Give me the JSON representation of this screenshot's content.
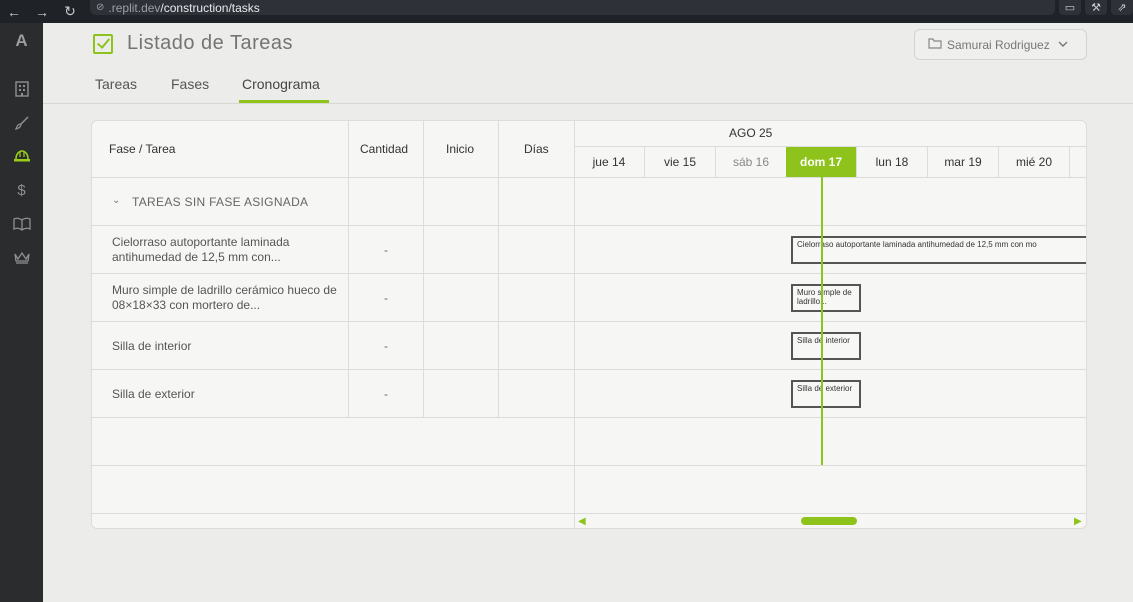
{
  "browser": {
    "url_host": ".replit.dev",
    "url_path": "/construction/tasks"
  },
  "sidebar": {
    "logo": "A",
    "items": [
      {
        "icon": "building-icon",
        "glyph": "▦"
      },
      {
        "icon": "brush-icon",
        "glyph": "✎"
      },
      {
        "icon": "hard-hat-icon",
        "glyph": "⛑"
      },
      {
        "icon": "dollar-icon",
        "glyph": "$"
      },
      {
        "icon": "book-icon",
        "glyph": "▯"
      },
      {
        "icon": "crown-icon",
        "glyph": "♕"
      }
    ],
    "active_color": "#9acd17"
  },
  "header": {
    "title": "Listado de Tareas",
    "user": "Samurai Rodriguez"
  },
  "tabs": {
    "items": [
      "Tareas",
      "Fases",
      "Cronograma"
    ],
    "active": "Cronograma"
  },
  "table": {
    "headers": {
      "phase_task": "Fase / Tarea",
      "quantity": "Cantidad",
      "start": "Inicio",
      "days": "Días"
    },
    "month": "AGO 25",
    "days": [
      {
        "label": "jue 14",
        "state": "normal"
      },
      {
        "label": "vie 15",
        "state": "normal"
      },
      {
        "label": "sáb 16",
        "state": "muted"
      },
      {
        "label": "dom 17",
        "state": "today"
      },
      {
        "label": "lun 18",
        "state": "normal"
      },
      {
        "label": "mar 19",
        "state": "normal"
      },
      {
        "label": "mié 20",
        "state": "normal"
      }
    ],
    "group": "TAREAS SIN FASE ASIGNADA",
    "tasks": [
      {
        "name": "Cielorraso autoportante laminada antihumedad de 12,5 mm con...",
        "quantity": "-",
        "bar_text": "Cielorraso autoportante laminada antihumedad de 12,5 mm con mo"
      },
      {
        "name": "Muro simple de ladrillo cerámico hueco de 08×18×33 con mortero de...",
        "quantity": "-",
        "bar_text": "Muro simple de ladrillo..."
      },
      {
        "name": "Silla de interior",
        "quantity": "-",
        "bar_text": "Silla de interior"
      },
      {
        "name": "Silla de exterior",
        "quantity": "-",
        "bar_text": "Silla de exterior"
      }
    ]
  },
  "colors": {
    "accent": "#8ec31c"
  }
}
